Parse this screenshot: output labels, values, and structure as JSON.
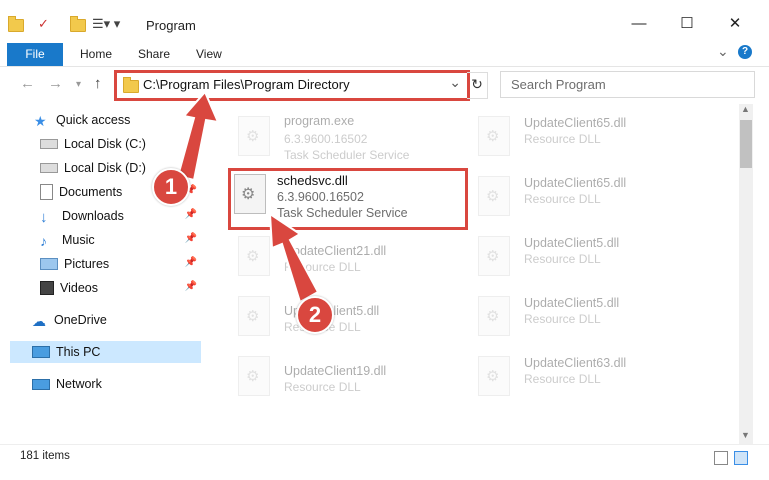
{
  "window": {
    "title": "Program",
    "minimize_label": "—",
    "maximize_label": "☐",
    "close_label": "✕"
  },
  "ribbon": {
    "file_tab": "File",
    "tabs": [
      "Home",
      "Share",
      "View"
    ],
    "expand_label": "⌄",
    "help_label": "?"
  },
  "address": {
    "path": "C:\\Program Files\\Program Directory",
    "dropdown_label": "⌄",
    "refresh_label": "↻"
  },
  "search": {
    "placeholder": "Search Program"
  },
  "sidebar": {
    "items": [
      {
        "label": "Quick access",
        "icon": "star-icon"
      },
      {
        "label": "Local Disk (C:)",
        "icon": "drive-icon",
        "pinned": true
      },
      {
        "label": "Local Disk (D:)",
        "icon": "drive-icon",
        "pinned": true
      },
      {
        "label": "Documents",
        "icon": "documents-icon",
        "pinned": true
      },
      {
        "label": "Downloads",
        "icon": "downloads-icon",
        "pinned": true
      },
      {
        "label": "Music",
        "icon": "music-icon",
        "pinned": true
      },
      {
        "label": "Pictures",
        "icon": "pictures-icon",
        "pinned": true
      },
      {
        "label": "Videos",
        "icon": "videos-icon",
        "pinned": true
      },
      {
        "label": "OneDrive",
        "icon": "cloud-icon"
      },
      {
        "label": "This PC",
        "icon": "computer-icon",
        "selected": true
      },
      {
        "label": "Network",
        "icon": "network-icon"
      }
    ]
  },
  "files": [
    {
      "name": "program.exe",
      "version": "6.3.9600.16502",
      "desc": "Task Scheduler Service"
    },
    {
      "name": "schedsvc.dll",
      "version": "6.3.9600.16502",
      "desc": "Task Scheduler Service"
    },
    {
      "name": "UpdateClient21.dll",
      "desc": "Resource DLL"
    },
    {
      "name": "UpdateClient5.dll",
      "desc": "Resource DLL"
    },
    {
      "name": "UpdateClient19.dll",
      "desc": "Resource DLL"
    },
    {
      "name": "UpdateClient65.dll",
      "desc": "Resource DLL"
    },
    {
      "name": "UpdateClient65.dll",
      "desc": "Resource DLL"
    },
    {
      "name": "UpdateClient5.dll",
      "desc": "Resource DLL"
    },
    {
      "name": "UpdateClient5.dll",
      "desc": "Resource DLL"
    },
    {
      "name": "UpdateClient63.dll",
      "desc": "Resource DLL"
    }
  ],
  "status": {
    "count": "181 items"
  },
  "annotations": {
    "step1": "1",
    "step2": "2",
    "color": "#d9473f"
  }
}
